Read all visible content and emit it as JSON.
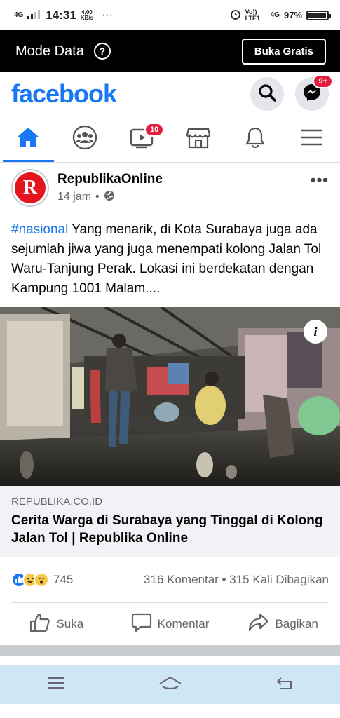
{
  "status_bar": {
    "network": "4G",
    "time": "14:31",
    "speed_value": "4,00",
    "speed_unit": "KB/s",
    "dots": "···",
    "volte": "Vo)) LTE1",
    "network2": "4G",
    "battery_percent": "97%",
    "battery_level": 0.97
  },
  "data_bar": {
    "title": "Mode Data",
    "help": "?",
    "button": "Buka Gratis"
  },
  "header": {
    "logo": "facebook",
    "messenger_badge": "9+"
  },
  "nav": {
    "watch_badge": "10"
  },
  "post": {
    "author": "RepublikaOnline",
    "avatar_letter": "R",
    "time": "14 jam",
    "dot": "•",
    "more": "•••",
    "hashtag": "#nasional",
    "text": " Yang menarik, di Kota Surabaya juga ada sejumlah jiwa yang juga menempati kolong Jalan Tol Waru-Tanjung Perak. Lokasi ini berdekatan dengan Kampung 1001 Malam....",
    "info": "i",
    "link": {
      "domain": "REPUBLIKA.CO.ID",
      "title": "Cerita Warga di Surabaya yang Tinggal di Kolong Jalan Tol | Republika Online"
    },
    "reactions_count": "745",
    "stats": "316 Komentar • 315 Kali Dibagikan",
    "actions": {
      "like": "Suka",
      "comment": "Komentar",
      "share": "Bagikan"
    }
  },
  "colors": {
    "brand": "#1877f2",
    "badge": "#e41e3f",
    "sys_nav": "#cfe6f5"
  }
}
